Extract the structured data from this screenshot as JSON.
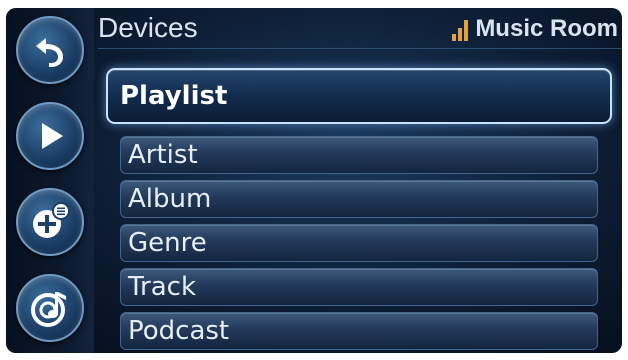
{
  "header": {
    "title": "Devices",
    "room": "Music Room",
    "signal_icon": "signal-strength-icon",
    "accent_color": "#e2a43a"
  },
  "left_rail": {
    "buttons": [
      {
        "icon": "back-arrow-icon"
      },
      {
        "icon": "play-icon"
      },
      {
        "icon": "add-to-queue-icon"
      },
      {
        "icon": "music-source-icon"
      }
    ]
  },
  "menu": {
    "selected_index": 0,
    "items": [
      {
        "label": "Playlist"
      },
      {
        "label": "Artist"
      },
      {
        "label": "Album"
      },
      {
        "label": "Genre"
      },
      {
        "label": "Track"
      },
      {
        "label": "Podcast"
      }
    ]
  }
}
